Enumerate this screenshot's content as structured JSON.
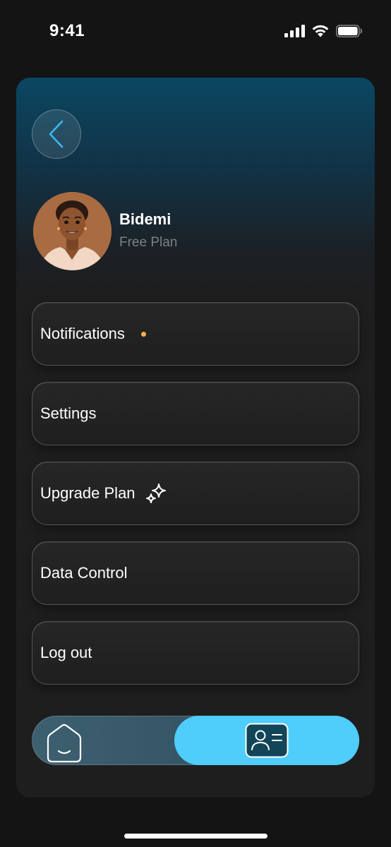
{
  "status_bar": {
    "time": "9:41",
    "icons": [
      "cellular-signal-icon",
      "wifi-icon",
      "battery-icon"
    ]
  },
  "profile": {
    "name": "Bidemi",
    "plan": "Free Plan",
    "avatar_icon": "avatar-illustration"
  },
  "menu": {
    "items": [
      {
        "label": "Notifications",
        "badge": "dot-indicator",
        "badge_color": "#f6b34a"
      },
      {
        "label": "Settings"
      },
      {
        "label": "Upgrade Plan",
        "icon": "sparkle-icon"
      },
      {
        "label": "Data Control"
      },
      {
        "label": "Log out"
      }
    ]
  },
  "tab_bar": {
    "tabs": [
      {
        "icon": "home-icon",
        "active": false
      },
      {
        "icon": "profile-card-icon",
        "active": true
      }
    ],
    "active_color": "#4fcdfb"
  },
  "colors": {
    "accent": "#4fcdfb",
    "back_chevron": "#3ab8f0",
    "card_top": "#0b4762",
    "card_bottom": "#1e1e1e"
  }
}
